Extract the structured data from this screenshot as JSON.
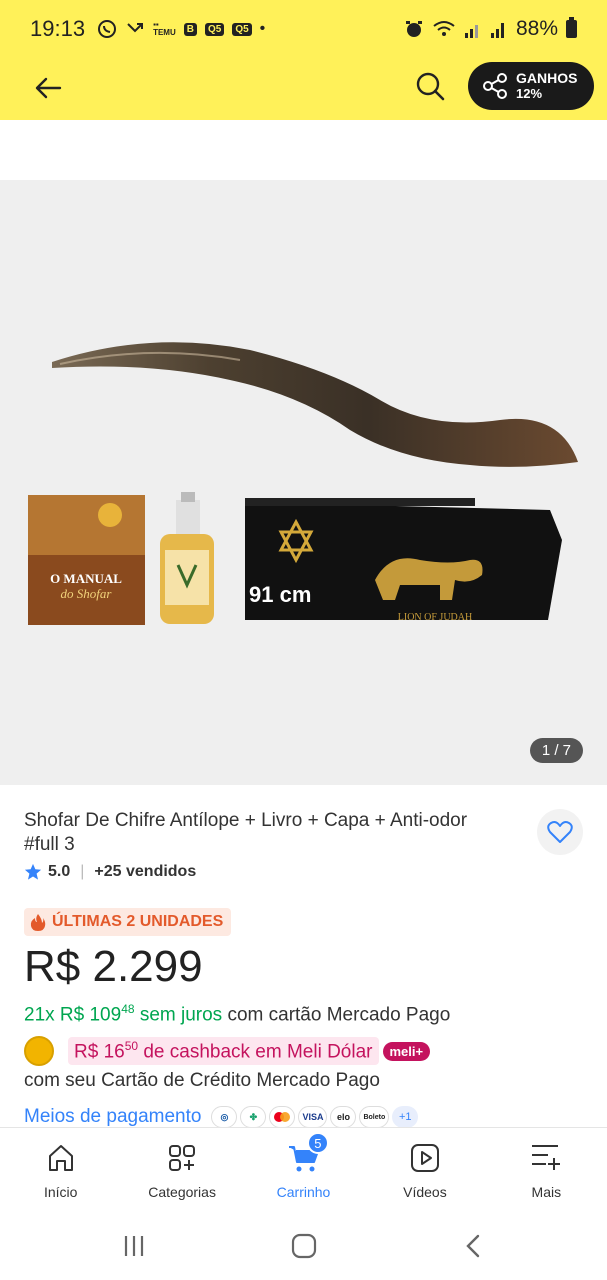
{
  "status_bar": {
    "time": "19:13",
    "left_icons": [
      "whatsapp-icon",
      "missed-call-icon",
      "temu-icon",
      "b-icon",
      "app-box-icon",
      "app-box-icon",
      "dot-icon"
    ],
    "app_box_label": "Q5",
    "battery": "88%"
  },
  "header": {
    "share_title": "GANHOS",
    "share_sub": "12%"
  },
  "gallery": {
    "counter": "1 / 7",
    "overlay_length": "91 cm",
    "book_title_1": "O MANUAL",
    "book_title_2": "do Shofar",
    "case_label": "LION OF JUDAH"
  },
  "product": {
    "title": "Shofar De Chifre Antílope + Livro + Capa + Anti-odor #full 3",
    "rating": "5.0",
    "sold": "+25 vendidos",
    "stock_badge": "ÚLTIMAS 2 UNIDADES",
    "price": "R$ 2.299",
    "installments_count": "21x R$ 109",
    "installments_cents": "48",
    "installments_interest": " sem juros",
    "installments_rest": " com cartão Mercado Pago",
    "cashback_value": "R$ 16",
    "cashback_cents": "50",
    "cashback_text": " de cashback em Meli Dólar",
    "meli_badge": "meli+",
    "card_note": "com seu Cartão de Crédito Mercado Pago",
    "payment_link": "Meios de pagamento",
    "payment_logos": [
      "",
      "",
      "",
      "VISA",
      "elo",
      "Boleto"
    ],
    "payment_more": "+1"
  },
  "bottom_nav": [
    {
      "label": "Início"
    },
    {
      "label": "Categorias"
    },
    {
      "label": "Carrinho",
      "badge": "5"
    },
    {
      "label": "Vídeos"
    },
    {
      "label": "Mais"
    }
  ],
  "colors": {
    "header_yellow": "#fff159",
    "accent_blue": "#3483fa",
    "green": "#00a650",
    "cashback_pink": "#c4135e"
  }
}
